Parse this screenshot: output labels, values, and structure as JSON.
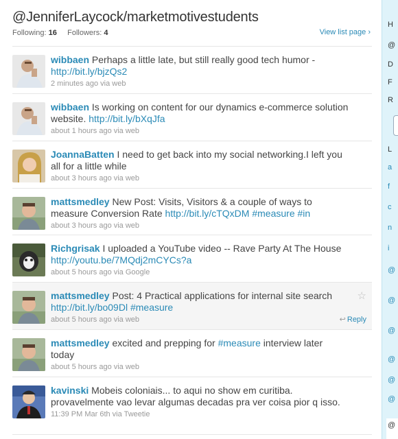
{
  "list": {
    "title": "@JenniferLaycock/marketmotivestudents",
    "following_label": "Following:",
    "following_count": "16",
    "followers_label": "Followers:",
    "followers_count": "4",
    "view_link": "View list page ›"
  },
  "tweets": [
    {
      "author": "wibbaen",
      "text": "Perhaps a little late, but still really good tech humor - ",
      "link": "http://bit.ly/bjzQs2",
      "meta": "2 minutes ago via web"
    },
    {
      "author": "wibbaen",
      "text": "Is working on content for our dynamics e-commerce solution website. ",
      "link": "http://bit.ly/bXqJfa",
      "meta": "about 1 hours ago via web"
    },
    {
      "author": "JoannaBatten",
      "text": "I need to get back into my social networking.I left you all for a little while",
      "meta": "about 3 hours ago via web"
    },
    {
      "author": "mattsmedley",
      "text": "New Post: Visits, Visitors & a couple of ways to measure Conversion Rate ",
      "link": "http://bit.ly/cTQxDM",
      "hashtag1": "#measure",
      "hashtag2": "#in",
      "meta": "about 3 hours ago via web"
    },
    {
      "author": "Richgrisak",
      "text": "I uploaded a YouTube video -- Rave Party At The House ",
      "link": "http://youtu.be/7MQdj2mCYCs?a",
      "meta": "about 5 hours ago via Google"
    },
    {
      "author": "mattsmedley",
      "text": "Post: 4 Practical applications for internal site search ",
      "link": "http://bit.ly/bo09Dl",
      "hashtag1": "#measure",
      "meta": "about 5 hours ago via web",
      "reply": "Reply",
      "star": "☆"
    },
    {
      "author": "mattsmedley",
      "text_before": "excited and prepping for ",
      "hashtag1": "#measure",
      "text_after": " interview later today",
      "meta": "about 5 hours ago via web"
    },
    {
      "author": "kavinski",
      "text": "Mobeis coloniais... to aqui no show em curitiba. provavelmente vao levar algumas decadas pra ver coisa pior q isso.",
      "meta": "11:39 PM Mar 6th via Tweetie"
    }
  ],
  "sidebar": {
    "items": [
      "H",
      "@",
      "D",
      "F",
      "R",
      "L",
      "a",
      "f",
      "c",
      "n",
      "i",
      "@",
      "@",
      "@",
      "@",
      "@",
      "@"
    ],
    "bottom": "@"
  },
  "colors": {
    "link": "#2a8ab6",
    "sidebar_bg": "#dff3fa",
    "hover_row": "#f5f5f5"
  }
}
